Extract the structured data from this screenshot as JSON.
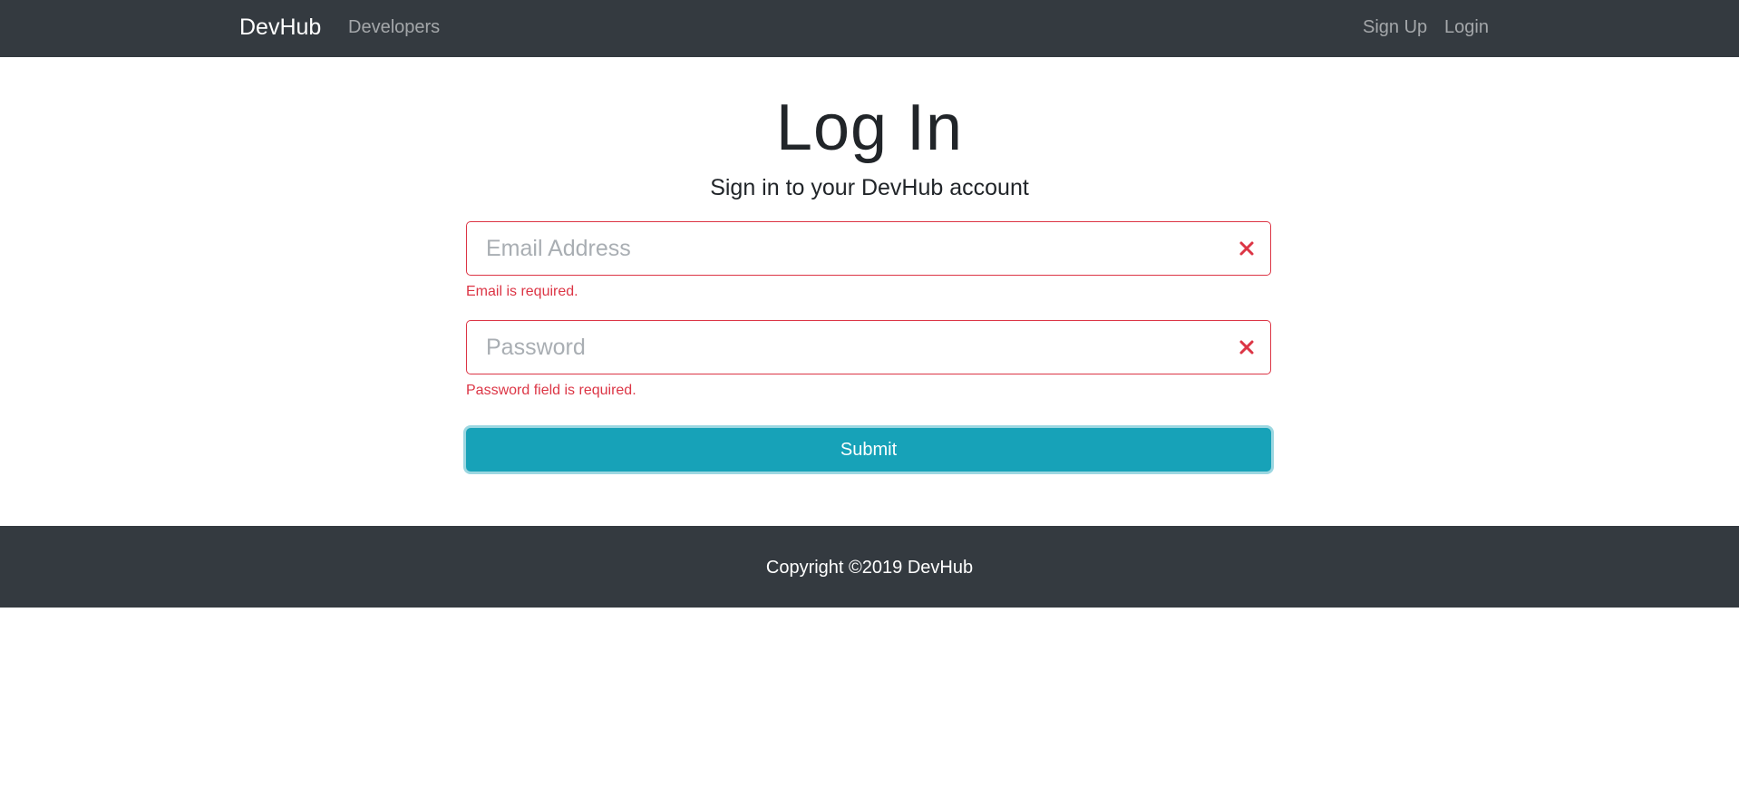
{
  "navbar": {
    "brand": "DevHub",
    "links": {
      "developers": "Developers",
      "sign_up": "Sign Up",
      "login": "Login"
    }
  },
  "main": {
    "title": "Log In",
    "subtitle": "Sign in to your DevHub account",
    "email": {
      "value": "",
      "placeholder": "Email Address",
      "error": "Email is required.",
      "icon": "invalid-x-icon"
    },
    "password": {
      "value": "",
      "placeholder": "Password",
      "error": "Password field is required.",
      "icon": "invalid-x-icon"
    },
    "submit_label": "Submit"
  },
  "footer": {
    "copyright": "Copyright ©2019 DevHub"
  },
  "colors": {
    "navbar_bg": "#343a40",
    "accent": "#17a2b8",
    "error": "#dc3545"
  }
}
